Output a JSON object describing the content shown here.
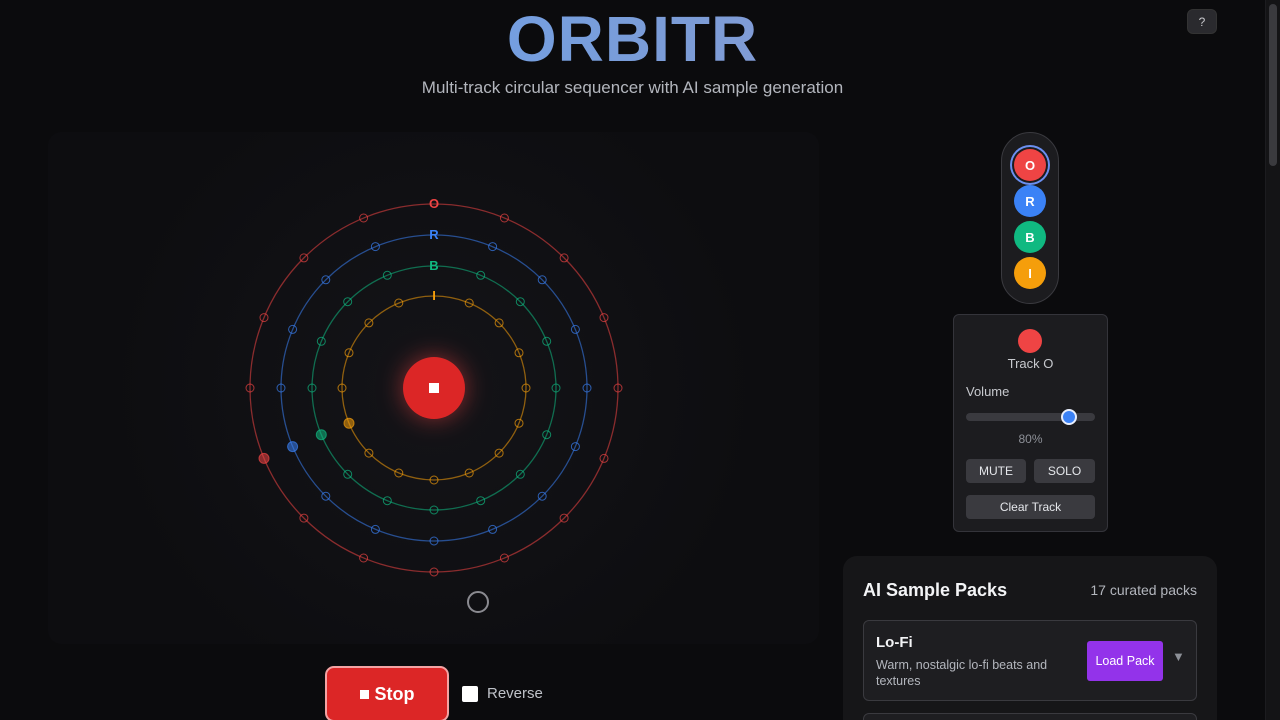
{
  "app": {
    "title": "ORBITR",
    "subtitle": "Multi-track circular sequencer with AI sample generation",
    "help_label": "?"
  },
  "sequencer": {
    "steps": 16,
    "tracks": [
      {
        "id": "O",
        "color": "#ef4444",
        "active_step": 11
      },
      {
        "id": "R",
        "color": "#3b82f6",
        "active_step": 11
      },
      {
        "id": "B",
        "color": "#10b981",
        "active_step": 11
      },
      {
        "id": "I",
        "color": "#f59e0b",
        "active_step": 11
      }
    ],
    "center_icon": "stop-square-icon"
  },
  "transport": {
    "stop_label": "Stop",
    "reverse_label": "Reverse",
    "reverse_checked": false
  },
  "track_selector": {
    "items": [
      {
        "label": "O",
        "color": "#ef4444",
        "active": true
      },
      {
        "label": "R",
        "color": "#3b82f6",
        "active": false
      },
      {
        "label": "B",
        "color": "#10b981",
        "active": false
      },
      {
        "label": "I",
        "color": "#f59e0b",
        "active": false
      }
    ]
  },
  "track_panel": {
    "color": "#ef4444",
    "name": "Track O",
    "volume_label": "Volume",
    "volume_value": 0.8,
    "volume_text": "80%",
    "mute_label": "MUTE",
    "solo_label": "SOLO",
    "clear_label": "Clear Track"
  },
  "packs": {
    "title": "AI Sample Packs",
    "count_text": "17 curated packs",
    "items": [
      {
        "name": "Lo-Fi",
        "description": "Warm, nostalgic lo-fi beats and textures",
        "load_label": "Load Pack",
        "chevron": "▼"
      }
    ]
  }
}
